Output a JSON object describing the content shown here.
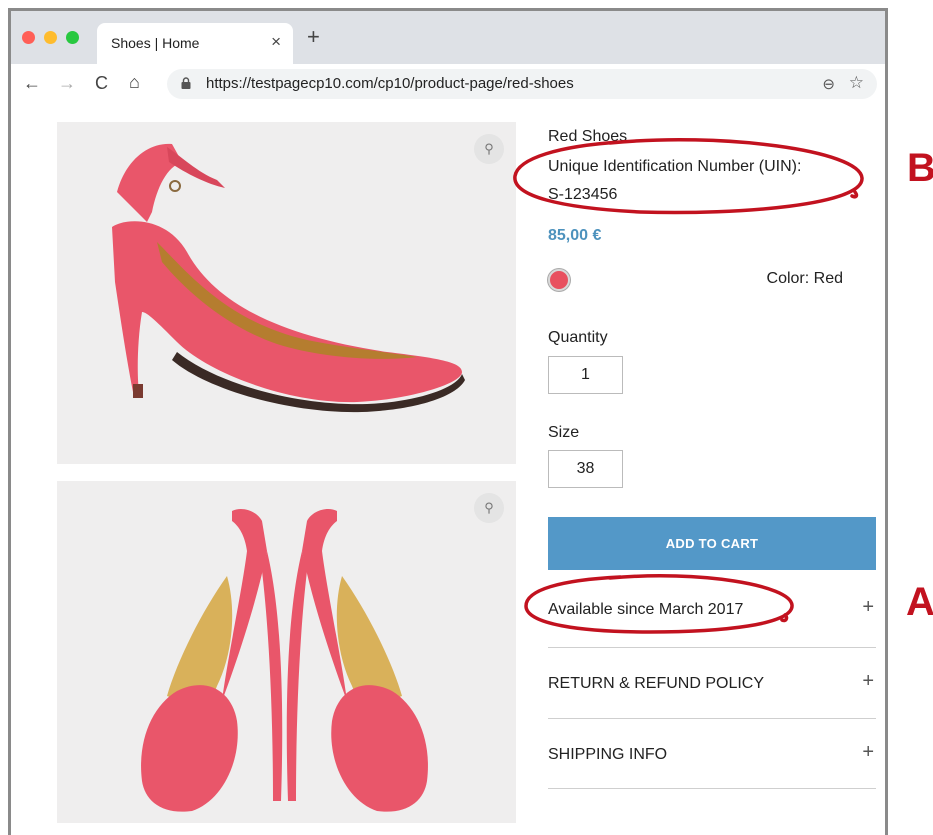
{
  "browser": {
    "tab_title": "Shoes | Home",
    "tab_close": "×",
    "new_tab": "+",
    "url": "https://testpagecp10.com/cp10/product-page/red-shoes",
    "nav": {
      "back": "←",
      "forward": "→",
      "reload": "C",
      "home": "⌂"
    },
    "zoom_glyph": "⊖",
    "star_glyph": "☆"
  },
  "product": {
    "name": "Red Shoes",
    "uin_label": "Unique Identification Number (UIN):",
    "uin_value": "S-123456",
    "price": "85,00 €",
    "color_label": "Color: Red",
    "swatch_color": "#e8505f",
    "quantity_label": "Quantity",
    "quantity_value": "1",
    "size_label": "Size",
    "size_value": "38",
    "add_to_cart": "ADD TO CART"
  },
  "gallery": {
    "zoom_glyph": "⚲"
  },
  "accordion": [
    {
      "label": "Available since March 2017",
      "toggle": "+"
    },
    {
      "label": "RETURN & REFUND POLICY",
      "toggle": "+"
    },
    {
      "label": "SHIPPING INFO",
      "toggle": "+"
    }
  ],
  "annotations": {
    "b_letter": "B",
    "a_letter": "A",
    "color": "#c2121f"
  },
  "colors": {
    "accent_button": "#5398c8",
    "price": "#4d92bd",
    "shoe": "#e9566a"
  }
}
